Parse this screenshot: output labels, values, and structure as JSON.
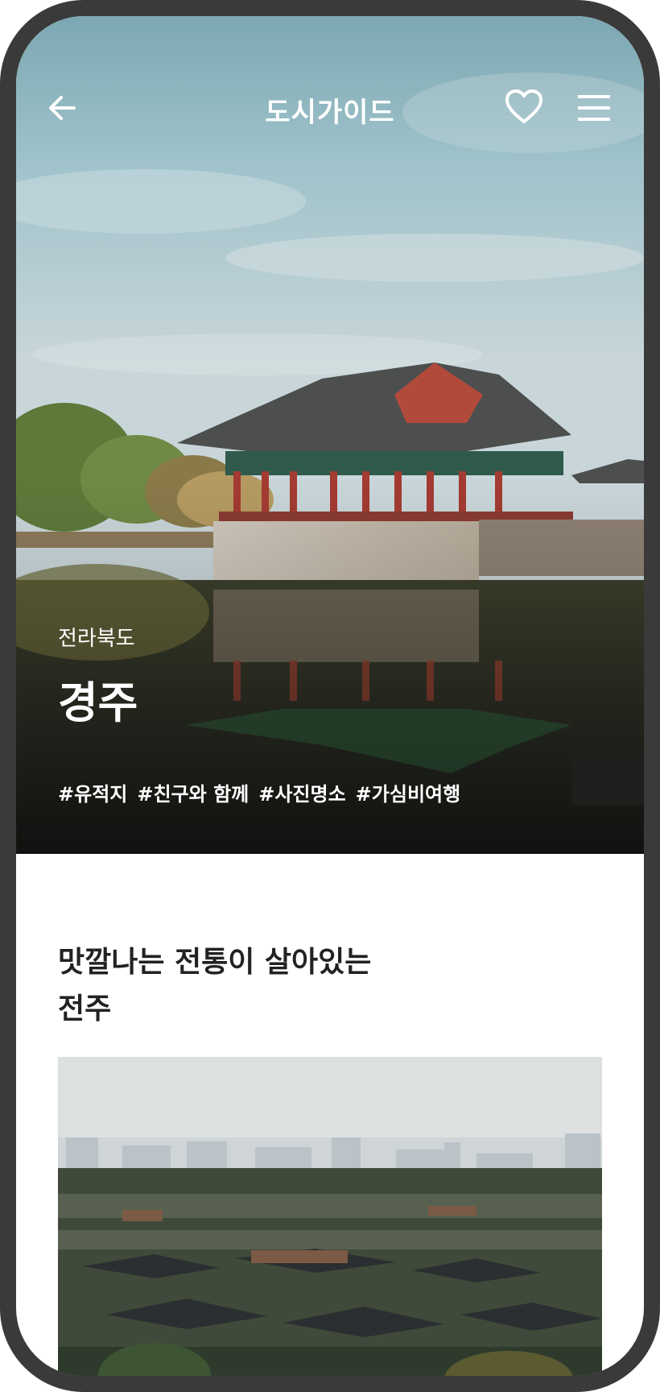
{
  "header": {
    "title": "도시가이드",
    "back_icon": "arrow-left-icon",
    "favorite_icon": "heart-outline-icon",
    "menu_icon": "hamburger-menu-icon"
  },
  "hero": {
    "region": "전라북도",
    "city": "경주",
    "tags": [
      "#유적지",
      "#친구와 함께",
      "#사진명소",
      "#가심비여행"
    ],
    "image": "traditional-korean-pavilion-reflected-in-pond"
  },
  "content": {
    "headline_lines": [
      "맛깔나는 전통이 살아있는",
      "전주"
    ],
    "image": "city-skyline-over-hanok-village"
  },
  "colors": {
    "device_frame": "#3a3a3a",
    "text_light": "#ffffff",
    "text_dark": "#222222",
    "sky": "#a7c4cc"
  }
}
